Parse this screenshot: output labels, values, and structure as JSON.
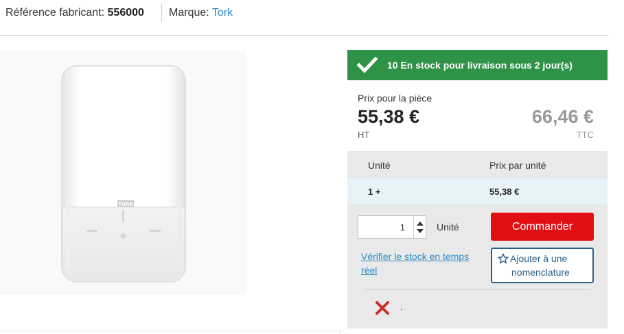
{
  "header": {
    "reference_label": "Référence fabricant:",
    "reference_value": "556000",
    "brand_label": "Marque:",
    "brand_value": "Tork"
  },
  "product": {
    "image_icon": "tork-dispenser-image",
    "logo_text": "TORK"
  },
  "stock": {
    "icon": "checkmark-icon",
    "text": "10 En stock pour livraison sous 2 jour(s)",
    "color": "#2e9247"
  },
  "price": {
    "label": "Prix pour la pièce",
    "ht_value": "55,38 €",
    "ht_label": "HT",
    "ttc_value": "66,46 €",
    "ttc_label": "TTC"
  },
  "price_table": {
    "headers": [
      "Unité",
      "Prix par unité"
    ],
    "rows": [
      {
        "unit": "1 +",
        "price": "55,38 €"
      }
    ]
  },
  "order": {
    "quantity": "1",
    "unit_label": "Unité",
    "order_button": "Commander",
    "order_button_color": "#e10f14",
    "stock_link": "Vérifier le stock en temps réel",
    "nomenclature_line1": "Ajouter à une",
    "nomenclature_line2": "nomenclature",
    "nomenclature_icon": "star-outline-icon",
    "remove_icon": "red-x-icon",
    "trailing_text": "."
  }
}
